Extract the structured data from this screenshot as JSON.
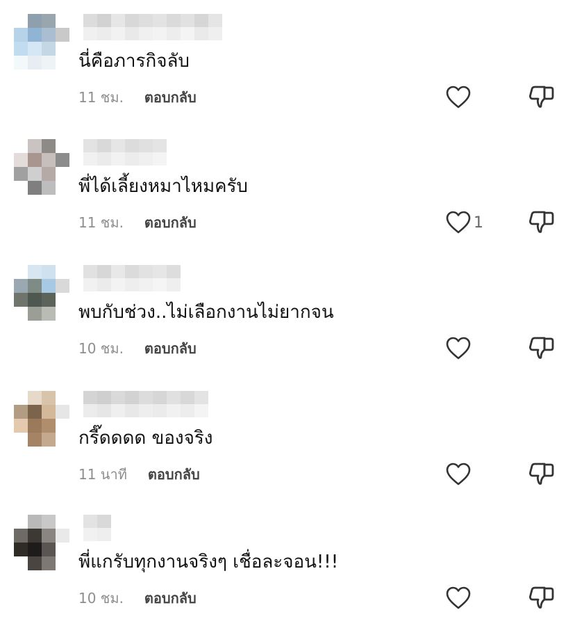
{
  "comments": [
    {
      "text": "นี่คือภารกิจลับ",
      "time": "11 ชม.",
      "reply_label": "ตอบกลับ",
      "like_count": "",
      "avatar_colors": [
        "#ffffff",
        "#8ea0ad",
        "#9aa6ae",
        "#ffffff",
        "#b7d3ea",
        "#8fb4d4",
        "#a9bfd1",
        "#c9c9c9",
        "#c2dcef",
        "#d5e7f4",
        "#c4d7e4",
        "#ffffff",
        "#f3f8fb",
        "#e6eef3",
        "#eef3f6",
        "#ffffff"
      ],
      "username_colors": [
        "#dcdcdc",
        "#f0f0f0",
        "#d2d2d2",
        "#ececec",
        "#e6e6e6",
        "#f2f2f2",
        "#d8d8d8",
        "#e9e9e9",
        "#dedede",
        "#f0f0f0",
        "#e3e3e3",
        "#f3f3f3",
        "#dadada",
        "#ededed",
        "#e1e1e1",
        "#f4f4f4",
        "#d6d6d6",
        "#eaeaea",
        "#e5e5e5",
        "#efefef"
      ]
    },
    {
      "text": "พี่ได้เลี้ยงหมาไหมครับ",
      "time": "11 ชม.",
      "reply_label": "ตอบกลับ",
      "like_count": "1",
      "avatar_colors": [
        "#ffffff",
        "#c9c3c1",
        "#8e8a88",
        "#ffffff",
        "#e3dcda",
        "#a89590",
        "#c7bfbc",
        "#8c8c8c",
        "#a0a0a0",
        "#cfcfcf",
        "#b5aaa6",
        "#ffffff",
        "#ffffff",
        "#7f7f7f",
        "#bdbdbd",
        "#ffffff"
      ],
      "username_colors": [
        "#e3e3e3",
        "#f1f1f1",
        "#d9d9d9",
        "#ebebeb",
        "#e6e6e6",
        "#f2f2f2",
        "#dcdcdc",
        "#ececec",
        "#e0e0e0",
        "#f0f0f0",
        "#e4e4e4",
        "#f4f4f4"
      ]
    },
    {
      "text": "พบกับช่วง..ไม่เลือกงานไม่ยากจน",
      "time": "10 ชม.",
      "reply_label": "ตอบกลับ",
      "like_count": "",
      "avatar_colors": [
        "#ffffff",
        "#d7e6f1",
        "#cfe0ee",
        "#ffffff",
        "#9aa8b2",
        "#7f8c86",
        "#a8c9e4",
        "#d9d9d9",
        "#6f756a",
        "#4e5850",
        "#5c6459",
        "#ffffff",
        "#ffffff",
        "#9a9e95",
        "#b9bcb5",
        "#ffffff"
      ],
      "username_colors": [
        "#e1e1e1",
        "#f1f1f1",
        "#d7d7d7",
        "#ebebeb",
        "#e8e8e8",
        "#f3f3f3",
        "#dbdbdb",
        "#eeeeee",
        "#e2e2e2",
        "#f1f1f1",
        "#e6e6e6",
        "#f5f5f5",
        "#dddddd",
        "#efefef"
      ]
    },
    {
      "text": "กรี๊ดดดด ของจริง",
      "time": "11 นาที",
      "reply_label": "ตอบกลับ",
      "like_count": "",
      "avatar_colors": [
        "#ffffff",
        "#e7d9c9",
        "#d8c3ab",
        "#ffffff",
        "#b39c84",
        "#7c634c",
        "#d4b89a",
        "#e6e6e6",
        "#e4c9ae",
        "#9b7a5c",
        "#b08d6d",
        "#ffffff",
        "#ffffff",
        "#a58465",
        "#c4a98e",
        "#ffffff"
      ],
      "username_colors": [
        "#d4d4d4",
        "#ececec",
        "#cfcfcf",
        "#e6e6e6",
        "#d9d9d9",
        "#efefef",
        "#d2d2d2",
        "#e8e8e8",
        "#dcdcdc",
        "#eeeeee",
        "#d6d6d6",
        "#ebebeb",
        "#e0e0e0",
        "#f1f1f1",
        "#d8d8d8",
        "#ededed",
        "#e3e3e3",
        "#f4f4f4"
      ]
    },
    {
      "text": "พี่แกรับทุกงานจริงๆ เชื่อละจอน!!!",
      "time": "10 ชม.",
      "reply_label": "ตอบกลับ",
      "like_count": "",
      "avatar_colors": [
        "#ffffff",
        "#b9b9b9",
        "#c8c8c8",
        "#ffffff",
        "#6f6a66",
        "#3c3834",
        "#8a8581",
        "#e9e9e9",
        "#2f2b27",
        "#1e1c1a",
        "#5a5552",
        "#ffffff",
        "#ffffff",
        "#4a4541",
        "#7d7874",
        "#ffffff"
      ],
      "username_colors": [
        "#e3e3e3",
        "#f1f1f1",
        "#d9d9d9",
        "#eeeeee"
      ]
    }
  ]
}
